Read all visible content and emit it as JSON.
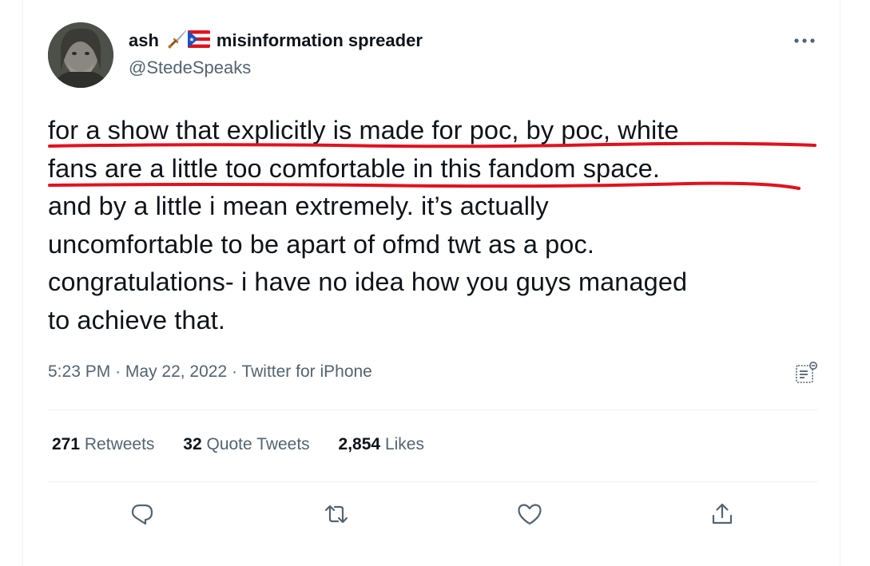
{
  "user": {
    "display_name": "ash",
    "display_name_suffix": "misinformation spreader",
    "emojis": [
      "dagger-emoji",
      "puerto-rico-flag-emoji"
    ],
    "handle": "@StedeSpeaks"
  },
  "tweet": {
    "lines": [
      "for a show that explicitly is made for poc, by poc, white",
      "fans are a little too comfortable in this fandom space.",
      "and by a little i mean extremely. it’s actually",
      "uncomfortable to be apart of ofmd twt as a poc.",
      "congratulations- i have no idea how you guys managed",
      "to achieve that."
    ],
    "underlined_lines": [
      0,
      1
    ],
    "underline_color": "#e0121f"
  },
  "meta": {
    "time": "5:23 PM",
    "separator": "·",
    "date": "May 22, 2022",
    "source": "Twitter for iPhone"
  },
  "stats": {
    "retweets_count": "271",
    "retweets_label": "Retweets",
    "quote_tweets_count": "32",
    "quote_tweets_label": "Quote Tweets",
    "likes_count": "2,854",
    "likes_label": "Likes"
  },
  "icons": {
    "more": "more-horizontal-icon",
    "analytics": "analytics-icon",
    "reply": "reply-icon",
    "retweet": "retweet-icon",
    "like": "heart-icon",
    "share": "share-icon"
  },
  "colors": {
    "text_primary": "#0f1419",
    "text_secondary": "#536471",
    "divider": "#eff3f4",
    "underline_red": "#e0121f"
  }
}
